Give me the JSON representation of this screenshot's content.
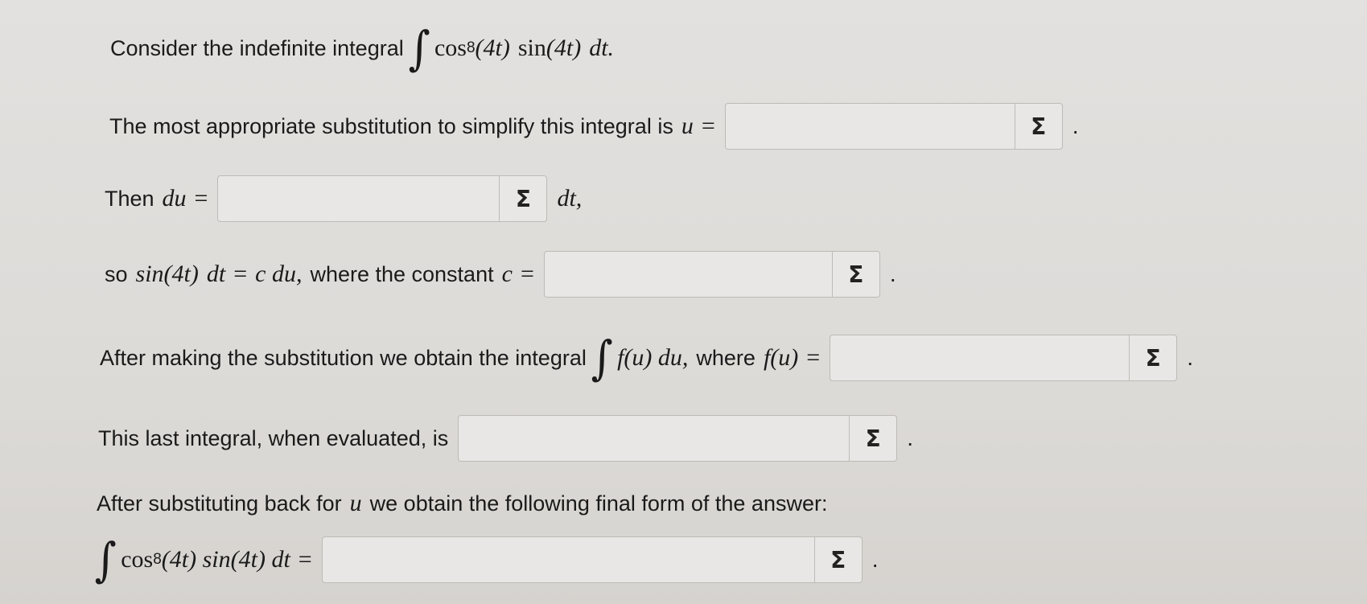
{
  "question": {
    "intro_text": "Consider the indefinite integral",
    "integrand": {
      "cos": "cos",
      "power": "8",
      "arg": "(4t)",
      "sin": "sin",
      "sin_arg": "(4t)",
      "d": "dt",
      "end": "."
    }
  },
  "step_u": {
    "label": "The most appropriate substitution to simplify this integral is",
    "var": "u",
    "equals": "=",
    "value": "",
    "end": "."
  },
  "step_du": {
    "label": "Then",
    "var": "du",
    "equals": "=",
    "value": "",
    "suffix": "dt,"
  },
  "step_c": {
    "prefix": "so",
    "expr_sin": "sin(4t)",
    "expr_rest": "dt",
    "equals": "=",
    "expr_cdu": "c du,",
    "label": "where the constant",
    "var": "c",
    "equals2": "=",
    "value": "",
    "end": "."
  },
  "step_f": {
    "label": "After making the substitution we obtain the integral",
    "integrand": "f(u) du,",
    "where": "where",
    "func": "f(u)",
    "equals": "=",
    "value": "",
    "end": "."
  },
  "step_eval": {
    "label": "This last integral, when evaluated, is",
    "value": "",
    "end": "."
  },
  "step_final": {
    "label_a": "After substituting back for",
    "var": "u",
    "label_b": "we obtain the following final form of the answer:",
    "lhs_cos": "cos",
    "lhs_power": "8",
    "lhs_rest": "(4t) sin(4t) dt",
    "equals": "=",
    "value": "",
    "end": "."
  },
  "sigma_label": "Σ"
}
